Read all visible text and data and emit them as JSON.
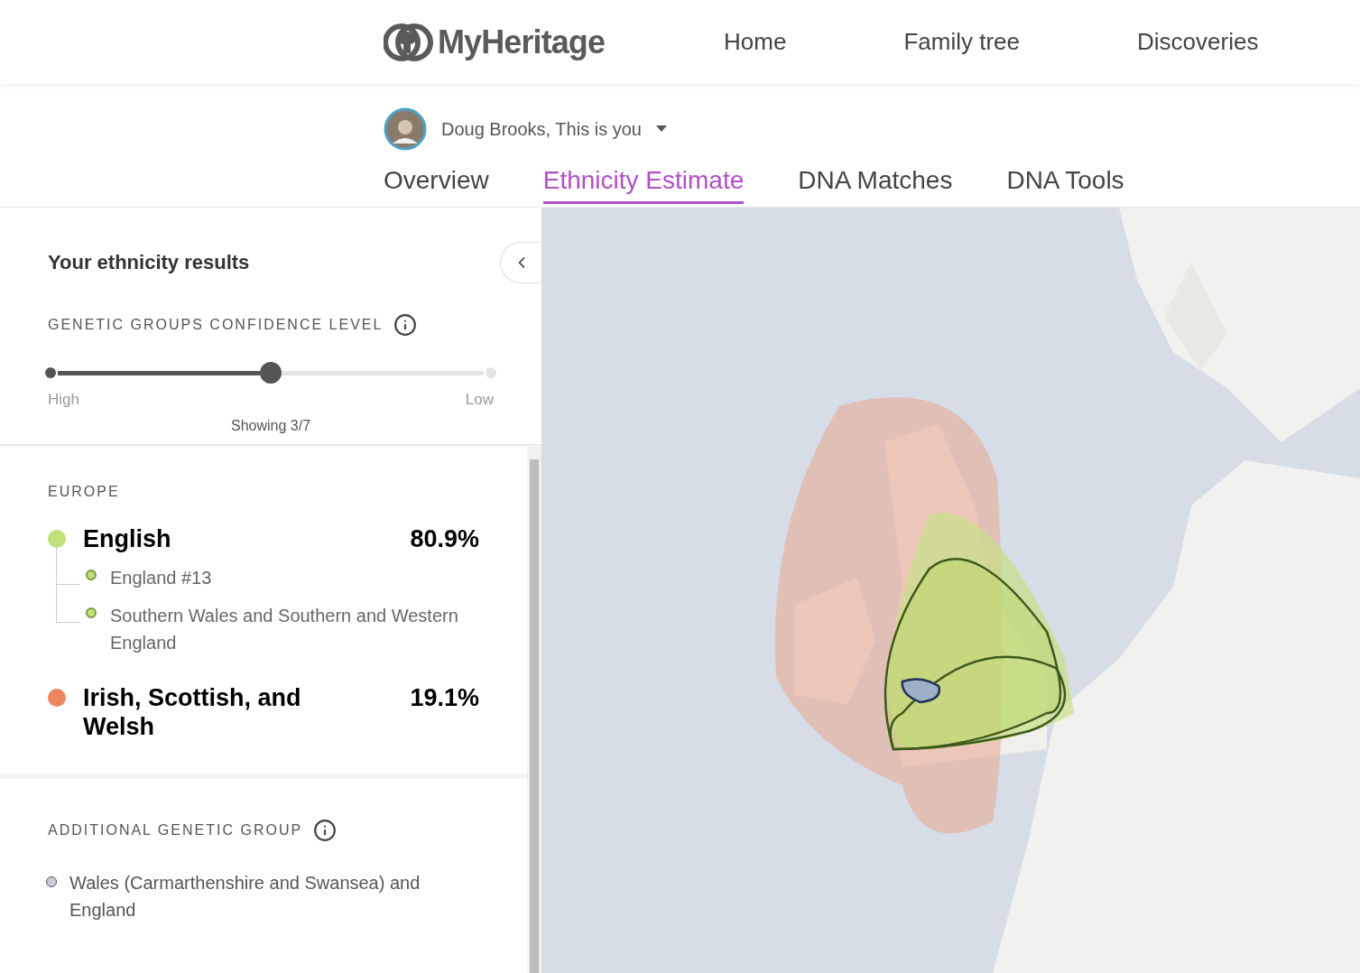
{
  "header": {
    "logo": "MyHeritage",
    "nav": [
      "Home",
      "Family tree",
      "Discoveries"
    ]
  },
  "profile": {
    "name": "Doug Brooks, This is you"
  },
  "tabs": [
    {
      "label": "Overview",
      "selected": false
    },
    {
      "label": "Ethnicity Estimate",
      "selected": true
    },
    {
      "label": "DNA Matches",
      "selected": false
    },
    {
      "label": "DNA Tools",
      "selected": false
    }
  ],
  "panel": {
    "title": "Your ethnicity results",
    "confidence": {
      "label": "GENETIC GROUPS CONFIDENCE LEVEL",
      "level": 0.5,
      "low_label": "Low",
      "high_label": "High",
      "showing": "Showing 3/7"
    },
    "region": "EUROPE",
    "ethnicities": [
      {
        "name": "English",
        "percent": "80.9%",
        "color": "#c1e07a",
        "groups": [
          {
            "name": "England #13"
          },
          {
            "name": "Southern Wales and Southern and Western England"
          }
        ]
      },
      {
        "name": "Irish, Scottish, and Welsh",
        "percent": "19.1%",
        "color": "#ec8560"
      }
    ],
    "additional": {
      "label": "ADDITIONAL GENETIC GROUP",
      "groups": [
        {
          "name": "Wales (Carmarthenshire and Swansea) and England",
          "color": "#c8cdd8"
        }
      ]
    }
  }
}
